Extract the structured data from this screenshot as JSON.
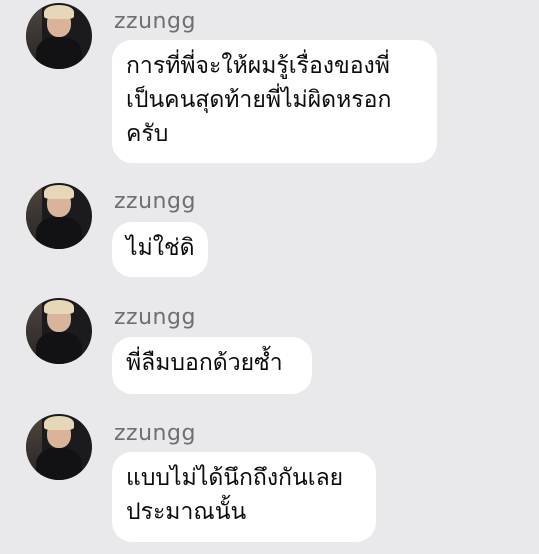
{
  "messages": [
    {
      "sender": "zzungg",
      "lines": [
        "การที่พี่จะให้ผมรู้เรื่องของพี่",
        "เป็นคนสุดท้ายพี่ไม่ผิดหรอก",
        "ครับ"
      ]
    },
    {
      "sender": "zzungg",
      "lines": [
        "ไม่ใช่ดิ"
      ]
    },
    {
      "sender": "zzungg",
      "lines": [
        "พี่ลืมบอกด้วยซ้ำ"
      ]
    },
    {
      "sender": "zzungg",
      "lines": [
        "แบบไม่ได้นึกถึงกันเลย",
        "ประมาณนั้น"
      ]
    }
  ]
}
